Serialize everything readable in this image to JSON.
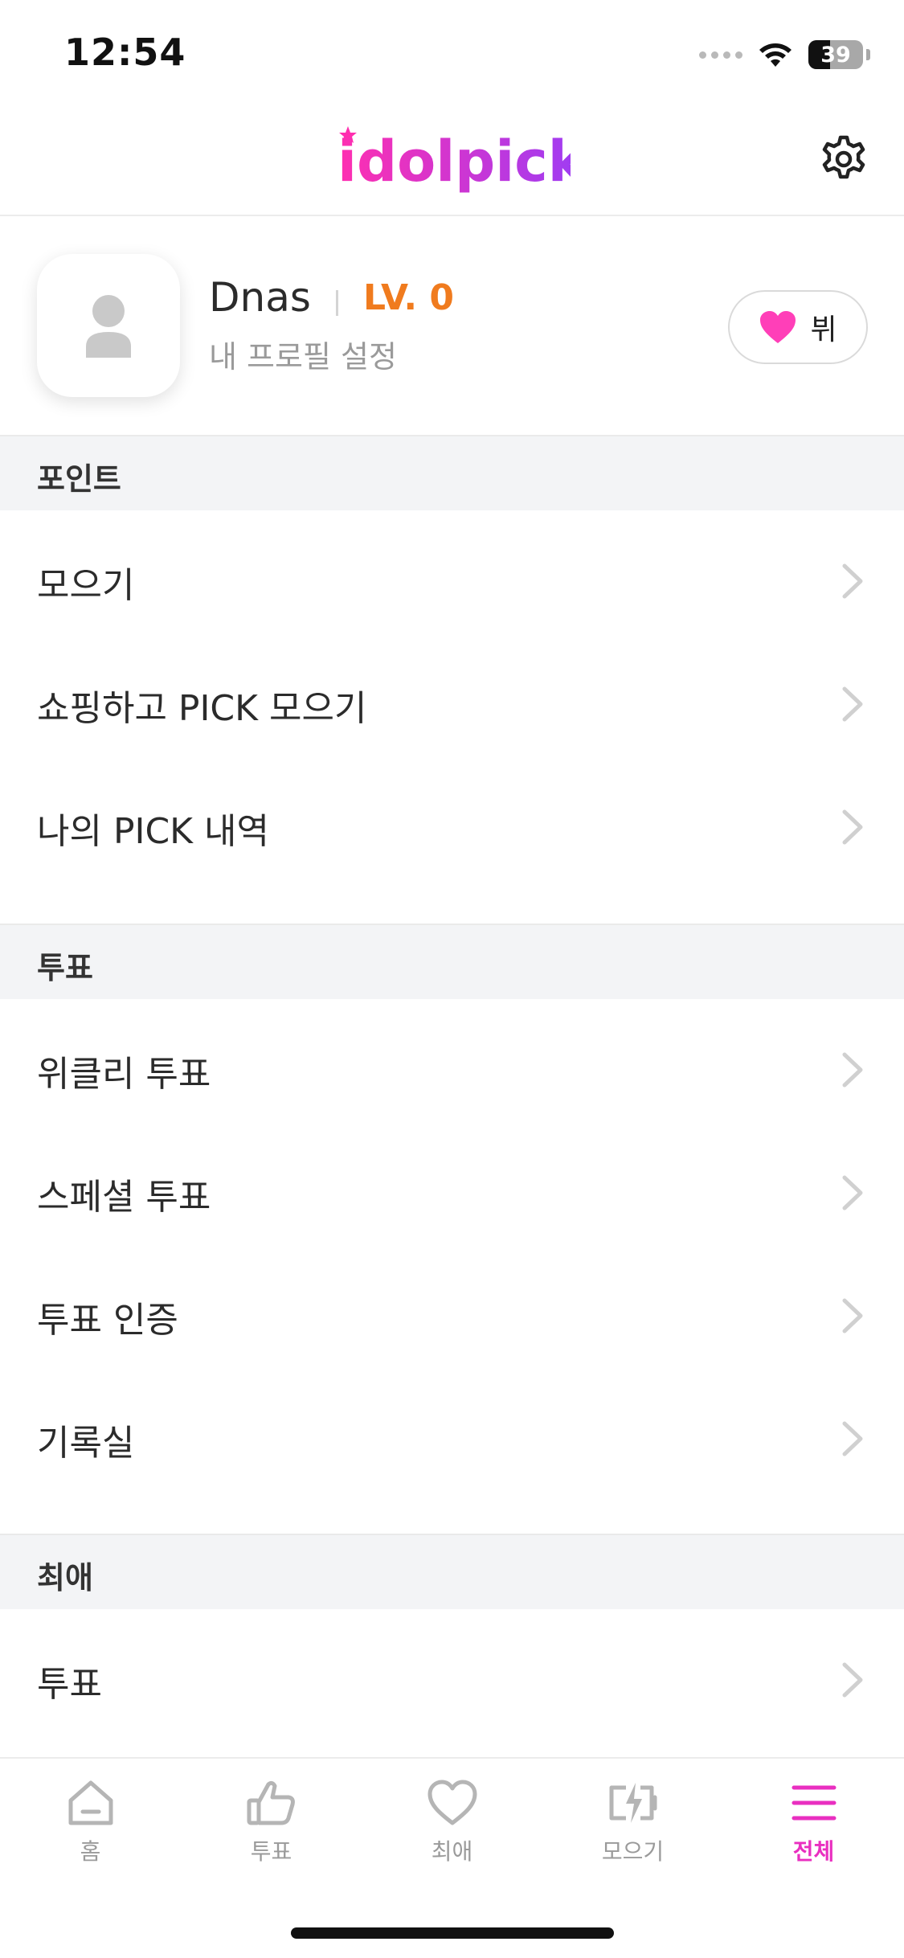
{
  "status_bar": {
    "time": "12:54",
    "battery": "39",
    "battery_level": 0.39
  },
  "header": {
    "logo_text": "idolpick",
    "settings_icon": "gear-icon"
  },
  "profile": {
    "name": "Dnas",
    "level": "LV. 0",
    "settings_link": "내 프로필 설정",
    "badge_label": "뷔",
    "badge_icon": "heart-icon"
  },
  "sections": {
    "points": {
      "title": "포인트",
      "items": [
        {
          "label": "모으기"
        },
        {
          "label": "쇼핑하고 PICK 모으기"
        },
        {
          "label": "나의 PICK 내역"
        }
      ]
    },
    "vote": {
      "title": "투표",
      "items": [
        {
          "label": "위클리 투표"
        },
        {
          "label": "스페셜 투표"
        },
        {
          "label": "투표 인증"
        },
        {
          "label": "기록실"
        }
      ]
    },
    "favorite": {
      "title": "최애",
      "items": [
        {
          "label": "투표"
        }
      ]
    }
  },
  "tab_bar": {
    "tabs": [
      {
        "label": "홈",
        "icon": "home-icon"
      },
      {
        "label": "투표",
        "icon": "thumbs-up-icon"
      },
      {
        "label": "최애",
        "icon": "heart-outline-icon"
      },
      {
        "label": "모으기",
        "icon": "battery-charge-icon"
      },
      {
        "label": "전체",
        "icon": "menu-icon"
      }
    ],
    "active_index": 4
  },
  "colors": {
    "accent": "#e92fc0",
    "level": "#f07b1e",
    "logo_gradient_start": "#ff2fb0",
    "logo_gradient_end": "#9b3df5"
  }
}
